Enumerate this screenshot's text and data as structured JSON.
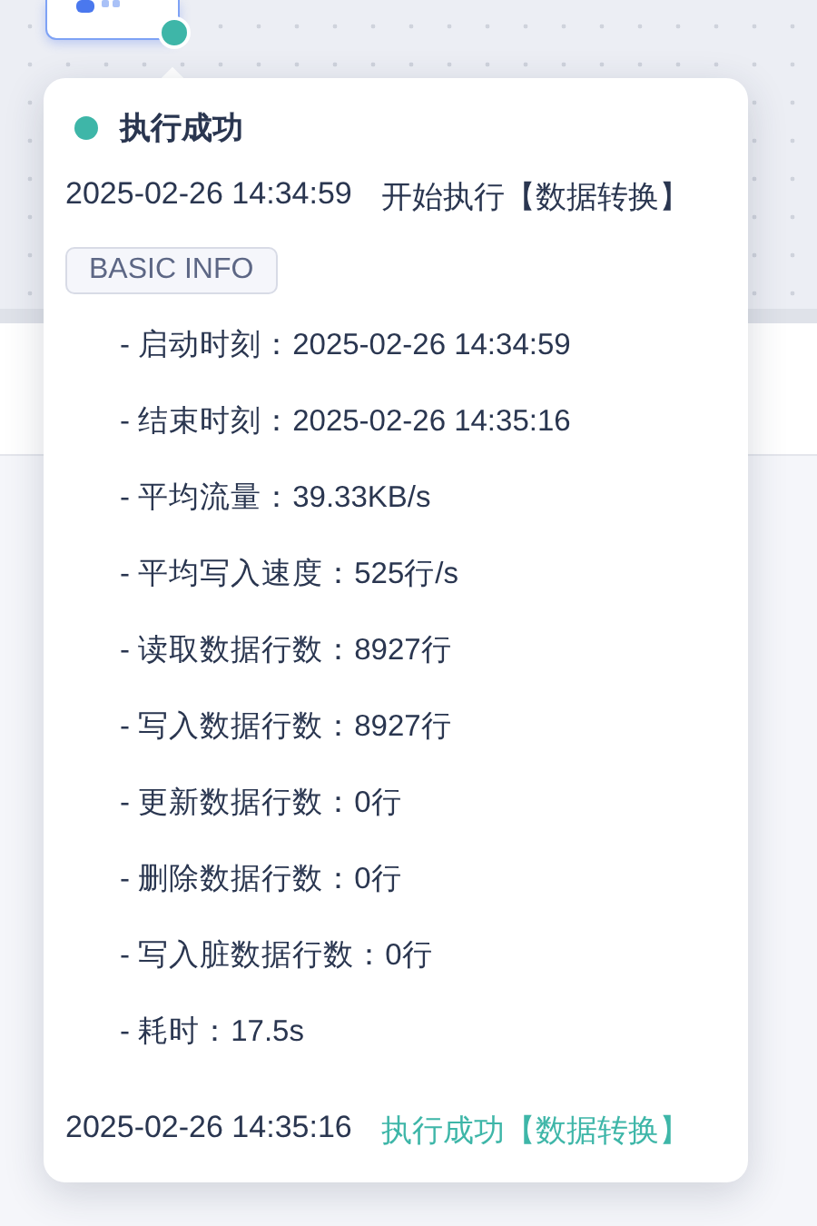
{
  "canvas": {
    "node": {
      "color": "#3eb6a8"
    }
  },
  "popup": {
    "title": "执行成功",
    "color": "#3eb6a8",
    "log": [
      {
        "time": "2025-02-26 14:34:59",
        "message": "开始执行【数据转换】",
        "color": "#2a3650"
      }
    ],
    "section_tag": "BASIC INFO",
    "details": [
      {
        "label": "- 启动时刻：",
        "value": "2025-02-26 14:34:59"
      },
      {
        "label": "- 结束时刻：",
        "value": "2025-02-26 14:35:16"
      },
      {
        "label": "- 平均流量：",
        "value": "39.33KB/s"
      },
      {
        "label": "- 平均写入速度：",
        "value": "525行/s"
      },
      {
        "label": "- 读取数据行数：",
        "value": "8927行"
      },
      {
        "label": "- 写入数据行数：",
        "value": "8927行"
      },
      {
        "label": "- 更新数据行数：",
        "value": "0行"
      },
      {
        "label": "- 删除数据行数：",
        "value": "0行"
      },
      {
        "label": "- 写入脏数据行数：",
        "value": "0行"
      },
      {
        "label": "- 耗时：",
        "value": "17.5s"
      }
    ],
    "footer_log": [
      {
        "time": "2025-02-26 14:35:16",
        "message": "执行成功【数据转换】",
        "color": "#3eb6a8"
      }
    ]
  }
}
